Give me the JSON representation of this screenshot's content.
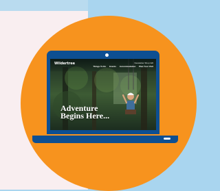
{
  "brand": {
    "name": "Wildertree"
  },
  "nav": {
    "top_links": "Newsletter   Shop   Gift",
    "items": [
      "Things To Do",
      "Events",
      "Accommodation",
      "Plan Your Visit"
    ]
  },
  "hero": {
    "line1": "Adventure",
    "line2": "Begins Here..."
  },
  "colors": {
    "background_blue": "#a9d5ef",
    "left_panel": "#f9eef0",
    "orange_circle": "#f7931e",
    "laptop_blue": "#0d4f92"
  },
  "icons": {
    "camera": "camera-dot-icon",
    "indicator": "power-light-icon"
  }
}
